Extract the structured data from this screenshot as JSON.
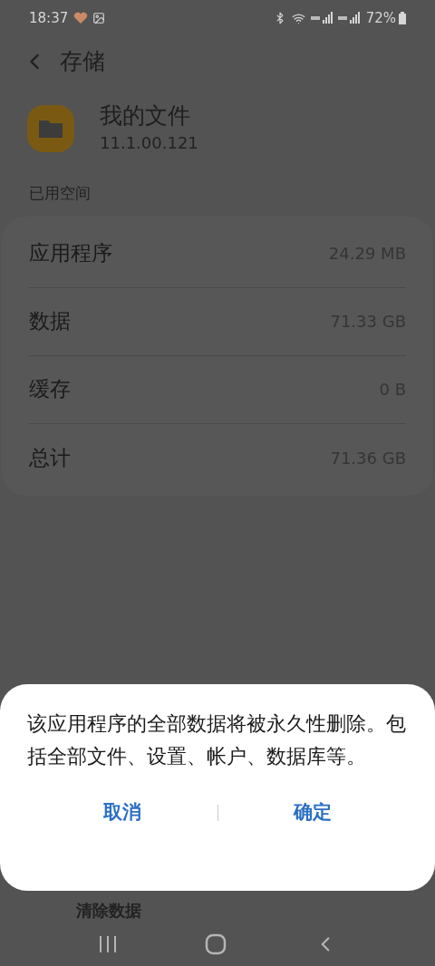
{
  "status_bar": {
    "time": "18:37",
    "battery": "72%"
  },
  "header": {
    "title": "存储"
  },
  "app": {
    "name": "我的文件",
    "version": "11.1.00.121"
  },
  "section_label": "已用空间",
  "rows": [
    {
      "label": "应用程序",
      "value": "24.29 MB"
    },
    {
      "label": "数据",
      "value": "71.33 GB"
    },
    {
      "label": "缓存",
      "value": "0 B"
    },
    {
      "label": "总计",
      "value": "71.36 GB"
    }
  ],
  "bottom_actions": [
    "清除数据"
  ],
  "dialog": {
    "message": "该应用程序的全部数据将被永久性删除。包括全部文件、设置、帐户、数据库等。",
    "buttons": [
      "取消",
      "确定"
    ]
  }
}
